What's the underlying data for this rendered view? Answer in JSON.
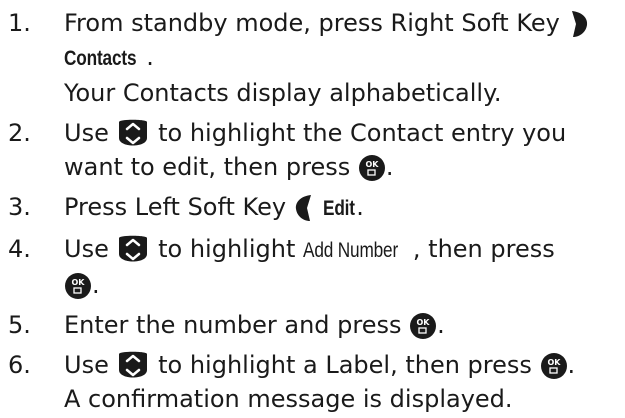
{
  "steps": [
    {
      "number": "1.",
      "text_a": "From standby mode, press Right Soft Key",
      "bold_label": "Contacts",
      "period": ".",
      "text_b": "Your Contacts display alphabetically."
    },
    {
      "number": "2.",
      "text_a": "Use",
      "text_b": "to highlight the Contact entry you",
      "text_c": "want to edit, then press",
      "period": "."
    },
    {
      "number": "3.",
      "text_a": "Press Left Soft Key",
      "bold_label": "Edit",
      "period": "."
    },
    {
      "number": "4.",
      "text_a": "Use",
      "text_b": "to highlight",
      "cond_label": "Add Number",
      "text_c": ", then press",
      "period": "."
    },
    {
      "number": "5.",
      "text_a": "Enter the number and press",
      "period": "."
    },
    {
      "number": "6.",
      "text_a": "Use",
      "text_b": "to highlight a Label, then press",
      "period": ".",
      "text_c": "A confirmation message is displayed."
    }
  ],
  "icons": {
    "nav": "nav-key-icon",
    "ok": "ok-key-icon",
    "right_soft": "right-soft-key-icon",
    "left_soft": "left-soft-key-icon"
  },
  "ok_glyph": "OK",
  "colors": {
    "text": "#1a1a1a",
    "key": "#1a1a1a",
    "key_glyph": "#ffffff"
  }
}
